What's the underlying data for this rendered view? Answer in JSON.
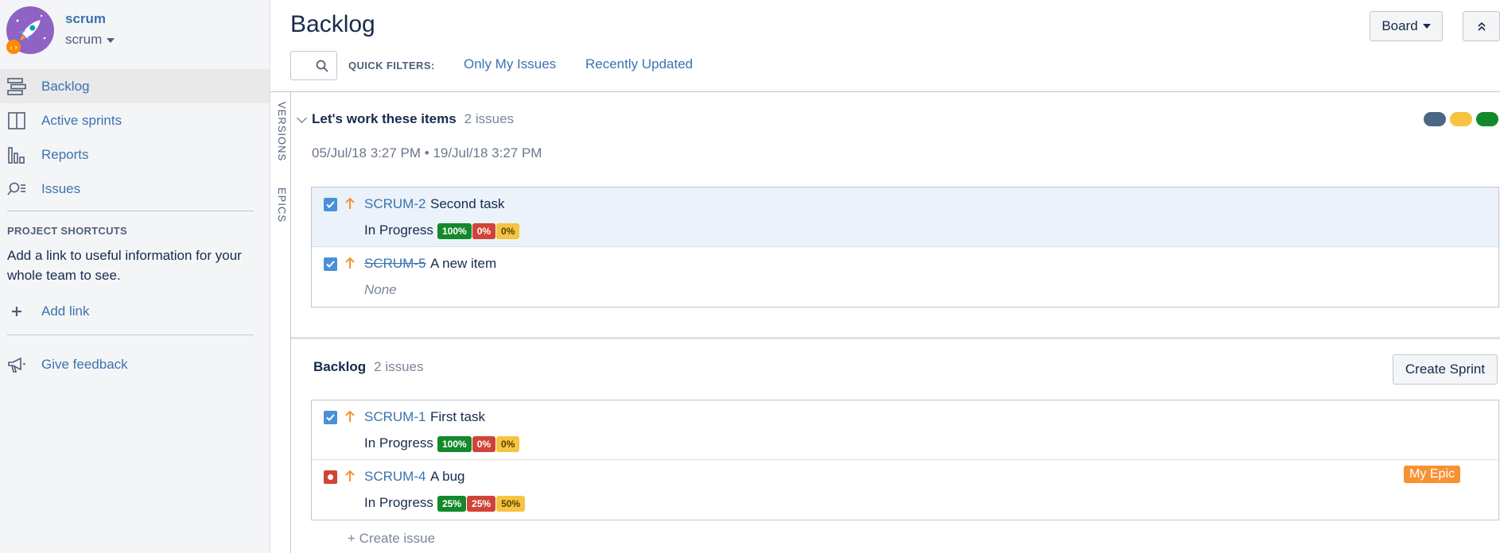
{
  "project": {
    "name": "scrum",
    "type": "scrum"
  },
  "nav": [
    {
      "id": "backlog",
      "label": "Backlog",
      "icon": "backlog-icon",
      "active": true
    },
    {
      "id": "active-sprints",
      "label": "Active sprints",
      "icon": "board-icon",
      "active": false
    },
    {
      "id": "reports",
      "label": "Reports",
      "icon": "reports-icon",
      "active": false
    },
    {
      "id": "issues",
      "label": "Issues",
      "icon": "issues-search-icon",
      "active": false
    }
  ],
  "shortcuts": {
    "title": "PROJECT SHORTCUTS",
    "text": "Add a link to useful information for your whole team to see.",
    "add_link": "Add link"
  },
  "feedback": "Give feedback",
  "side_tabs": {
    "versions": "VERSIONS",
    "epics": "EPICS"
  },
  "header": {
    "title": "Backlog",
    "board_button": "Board"
  },
  "quick_filters": {
    "label": "QUICK FILTERS:",
    "items": [
      "Only My Issues",
      "Recently Updated"
    ]
  },
  "sprint": {
    "name": "Let's work these items",
    "count": "2 issues",
    "dates": "05/Jul/18 3:27 PM  •  19/Jul/18 3:27 PM",
    "status_colors": [
      "#4a6785",
      "#f6c342",
      "#14892c"
    ],
    "issues": [
      {
        "key": "SCRUM-2",
        "summary": "Second task",
        "status": "In Progress",
        "type": "task",
        "done": false,
        "selected": true,
        "progress": [
          {
            "label": "100%",
            "color": "g"
          },
          {
            "label": "0%",
            "color": "r"
          },
          {
            "label": "0%",
            "color": "y"
          }
        ]
      },
      {
        "key": "SCRUM-5",
        "summary": "A new item",
        "status": "None",
        "type": "task",
        "done": true,
        "selected": false,
        "progress": []
      }
    ]
  },
  "backlog": {
    "name": "Backlog",
    "count": "2 issues",
    "create_sprint": "Create Sprint",
    "issues": [
      {
        "key": "SCRUM-1",
        "summary": "First task",
        "status": "In Progress",
        "type": "task",
        "done": false,
        "selected": false,
        "progress": [
          {
            "label": "100%",
            "color": "g"
          },
          {
            "label": "0%",
            "color": "r"
          },
          {
            "label": "0%",
            "color": "y"
          }
        ]
      },
      {
        "key": "SCRUM-4",
        "summary": "A bug",
        "status": "In Progress",
        "type": "bug",
        "done": false,
        "selected": false,
        "epic": "My Epic",
        "progress": [
          {
            "label": "25%",
            "color": "g"
          },
          {
            "label": "25%",
            "color": "r"
          },
          {
            "label": "50%",
            "color": "y"
          }
        ]
      }
    ],
    "create_issue": "+   Create issue"
  }
}
